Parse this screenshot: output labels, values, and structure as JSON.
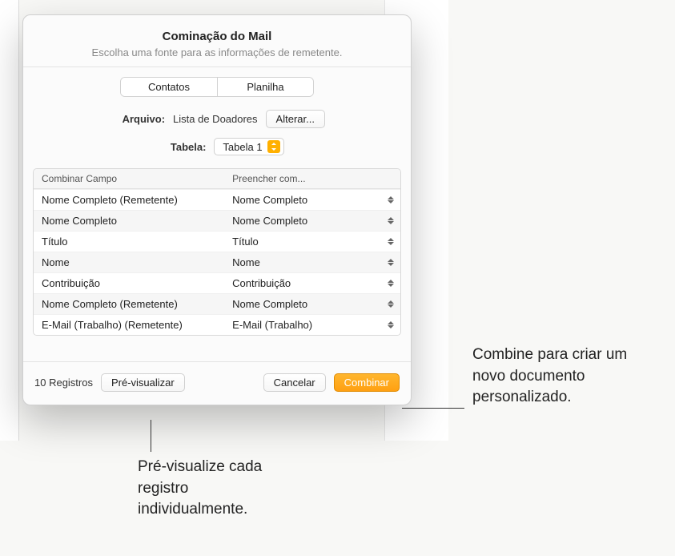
{
  "dialog": {
    "title": "Cominação do Mail",
    "subtitle": "Escolha uma fonte para as informações de remetente."
  },
  "tabs": {
    "contacts": "Contatos",
    "spreadsheet": "Planilha"
  },
  "file": {
    "label": "Arquivo:",
    "value": "Lista de Doadores",
    "change": "Alterar..."
  },
  "table_select": {
    "label": "Tabela:",
    "value": "Tabela 1"
  },
  "grid": {
    "header_field": "Combinar Campo",
    "header_fill": "Preencher com...",
    "rows": [
      {
        "field": "Nome Completo (Remetente)",
        "fill": "Nome Completo"
      },
      {
        "field": "Nome Completo",
        "fill": "Nome Completo"
      },
      {
        "field": "Título",
        "fill": "Título"
      },
      {
        "field": "Nome",
        "fill": "Nome"
      },
      {
        "field": "Contribuição",
        "fill": "Contribuição"
      },
      {
        "field": "Nome Completo (Remetente)",
        "fill": "Nome Completo"
      },
      {
        "field": "E-Mail (Trabalho) (Remetente)",
        "fill": "E-Mail (Trabalho)"
      }
    ]
  },
  "footer": {
    "records": "10 Registros",
    "preview": "Pré-visualizar",
    "cancel": "Cancelar",
    "merge": "Combinar"
  },
  "callouts": {
    "right": "Combine para criar um novo documento personalizado.",
    "bottom": "Pré-visualize cada registro individualmente."
  }
}
